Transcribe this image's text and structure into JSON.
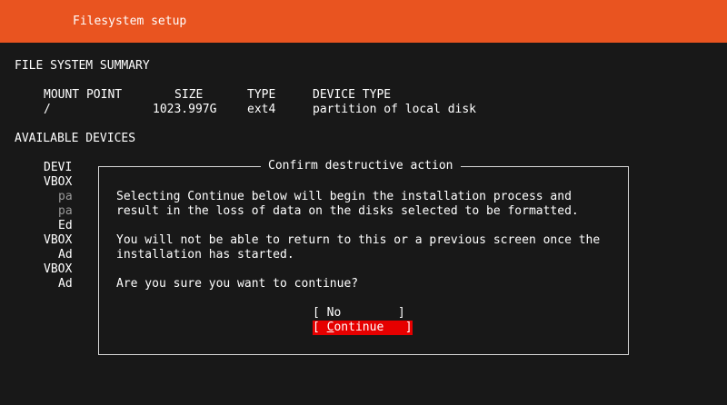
{
  "header": {
    "title": "Filesystem setup"
  },
  "summary": {
    "heading": "FILE SYSTEM SUMMARY",
    "columns": {
      "mount": "MOUNT POINT",
      "size": "SIZE",
      "type": "TYPE",
      "device_type": "DEVICE TYPE"
    },
    "row": {
      "mount": "/",
      "size": "1023.997G",
      "type": "ext4",
      "device_type": "partition of local disk"
    }
  },
  "available": {
    "heading": "AVAILABLE DEVICES",
    "lines": [
      "DEVI",
      "VBOX",
      "pa",
      "pa",
      "Ed",
      "VBOX",
      "Ad",
      "VBOX",
      "Ad"
    ]
  },
  "dialog": {
    "title": "Confirm destructive action",
    "para1_line1": "Selecting Continue below will begin the installation process and",
    "para1_line2": "result in the loss of data on the disks selected to be formatted.",
    "para2_line1": "You will not be able to return to this or a previous screen once the",
    "para2_line2": "installation has started.",
    "question": "Are you sure you want to continue?",
    "buttons": {
      "no": {
        "open": "[ ",
        "label": "No",
        "close": "        ]"
      },
      "continue": {
        "open": "[ ",
        "hotkey": "C",
        "rest": "ontinue",
        "close": "   ]"
      }
    }
  },
  "colors": {
    "header": "#e95420",
    "background": "#181818",
    "focus": "#e60000",
    "dim_text": "#9a9a9a"
  }
}
